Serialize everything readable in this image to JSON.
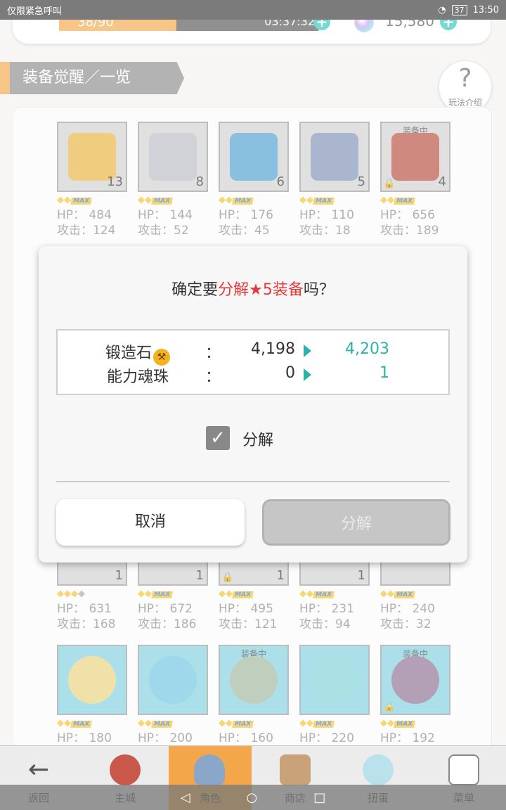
{
  "statusbar": {
    "carrier": "仅限紧急呼叫",
    "battery": "37",
    "time": "13:50"
  },
  "resources": {
    "stamina": "38/90",
    "stamina_fraction": 0.45,
    "timer": "03:37:32",
    "gems": "15,580"
  },
  "title": "装备觉醒／一览",
  "help_label": "玩法介绍",
  "items_row1": [
    {
      "count": "13",
      "hp": "HP： 484",
      "atk": "攻击：124",
      "color": "#e8b23a",
      "tag": "",
      "lock": false
    },
    {
      "count": "8",
      "hp": "HP： 144",
      "atk": "攻击：52",
      "color": "#b9b9c4",
      "tag": "",
      "lock": false
    },
    {
      "count": "6",
      "hp": "HP： 176",
      "atk": "攻击：45",
      "color": "#4b9fd0",
      "tag": "",
      "lock": false
    },
    {
      "count": "5",
      "hp": "HP： 110",
      "atk": "攻击：18",
      "color": "#7d8fb2",
      "tag": "",
      "lock": false
    },
    {
      "count": "4",
      "hp": "HP： 656",
      "atk": "攻击：189",
      "color": "#b74b3a",
      "tag": "装备中",
      "lock": true
    }
  ],
  "items_row2": [
    {
      "count": "1",
      "hp": "HP： 631",
      "atk": "攻击：168",
      "lock": false
    },
    {
      "count": "1",
      "hp": "HP： 672",
      "atk": "攻击：186",
      "lock": false
    },
    {
      "count": "1",
      "hp": "HP： 495",
      "atk": "攻击：121",
      "lock": true
    },
    {
      "count": "1",
      "hp": "HP： 231",
      "atk": "攻击：94",
      "lock": false
    },
    {
      "count": "",
      "hp": "HP： 240",
      "atk": "攻击：32",
      "lock": false
    }
  ],
  "items_row3": [
    {
      "hp": "HP： 180",
      "tag": "",
      "color": "#e9d27a",
      "lock": false
    },
    {
      "hp": "HP： 200",
      "tag": "",
      "color": "#6cc3df",
      "lock": false
    },
    {
      "hp": "HP： 160",
      "tag": "装备中",
      "color": "#9fb59a",
      "lock": false
    },
    {
      "hp": "HP： 220",
      "tag": "",
      "color": "#7bd1d8",
      "lock": false
    },
    {
      "hp": "HP： 192",
      "tag": "装备中",
      "color": "#8b6e8f",
      "lock": true
    }
  ],
  "max_label": "MAX",
  "dialog": {
    "question_pre": "确定要",
    "question_red": "分解★5装备",
    "question_post": "吗？",
    "rows": [
      {
        "label": "锻造石",
        "from": "4,198",
        "to": "4,203"
      },
      {
        "label": "能力魂珠",
        "from": "0",
        "to": "1"
      }
    ],
    "colon": "：",
    "checkbox_label": "分解",
    "cancel": "取消",
    "confirm": "分解"
  },
  "nav": [
    {
      "label": "返回"
    },
    {
      "label": "主城"
    },
    {
      "label": "角色"
    },
    {
      "label": "商店"
    },
    {
      "label": "扭蛋"
    },
    {
      "label": "菜单"
    }
  ]
}
